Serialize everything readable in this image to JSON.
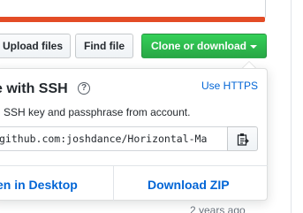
{
  "toolbar": {
    "upload_label": "Upload files",
    "find_label": "Find file",
    "clone_label": "Clone or download"
  },
  "clone_panel": {
    "title": "e with SSH",
    "switch_protocol_label": "Use HTTPS",
    "description": "n SSH key and passphrase from account.",
    "url_value": "github.com:joshdance/Horizontal-Ma",
    "open_desktop_label": "en in Desktop",
    "download_zip_label": "Download ZIP",
    "help_icon": "question-circle-icon",
    "copy_icon": "clipboard-icon"
  },
  "file_list": {
    "age": "2 years ago"
  },
  "colors": {
    "language_bar": "#e34c26",
    "primary_button": "#28a745",
    "link": "#0366d6"
  }
}
